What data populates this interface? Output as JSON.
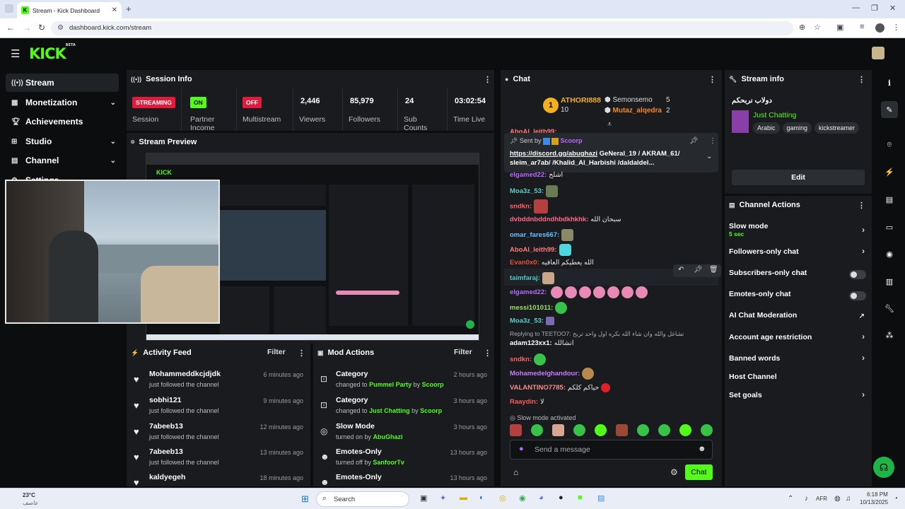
{
  "browser": {
    "tab_title": "Stream - Kick Dashboard",
    "url": "dashboard.kick.com/stream"
  },
  "header": {
    "logo": "KICK",
    "logo_badge": "BETA"
  },
  "sidebar": {
    "items": [
      {
        "label": "Stream",
        "icon": "broadcast-icon"
      },
      {
        "label": "Monetization",
        "icon": "dollar-icon"
      },
      {
        "label": "Achievements",
        "icon": "trophy-icon"
      },
      {
        "label": "Studio",
        "icon": "studio-icon"
      },
      {
        "label": "Channel",
        "icon": "channel-icon"
      },
      {
        "label": "Settings",
        "icon": "gear-icon"
      }
    ]
  },
  "session": {
    "title": "Session Info",
    "stats": [
      {
        "value": "STREAMING",
        "label": "Session",
        "badge_color": "#e21b3c"
      },
      {
        "value": "ON",
        "label": "Partner Income",
        "badge_color": "#53fc18"
      },
      {
        "value": "OFF",
        "label": "Multistream",
        "badge_color": "#e21b3c"
      },
      {
        "value": "2,446",
        "label": "Viewers"
      },
      {
        "value": "85,979",
        "label": "Followers"
      },
      {
        "value": "24",
        "label": "Sub Counts"
      },
      {
        "value": "03:02:54",
        "label": "Time Live"
      }
    ]
  },
  "preview": {
    "title": "Stream Preview"
  },
  "activity": {
    "title": "Activity Feed",
    "filter": "Filter",
    "rows": [
      {
        "name": "Mohammeddkcjdjdk",
        "sub": "just followed the channel",
        "time": "6 minutes ago"
      },
      {
        "name": "sobhi121",
        "sub": "just followed the channel",
        "time": "9 minutes ago"
      },
      {
        "name": "7abeeb13",
        "sub": "just followed the channel",
        "time": "12 minutes ago"
      },
      {
        "name": "7abeeb13",
        "sub": "just followed the channel",
        "time": "13 minutes ago"
      },
      {
        "name": "kaldyegeh",
        "sub": "",
        "time": "18 minutes ago"
      }
    ]
  },
  "mod": {
    "title": "Mod Actions",
    "filter": "Filter",
    "rows": [
      {
        "name": "Category",
        "prefix": "changed to",
        "value": "Pummel Party",
        "by": "by",
        "user": "Scoorp",
        "time": "2 hours ago"
      },
      {
        "name": "Category",
        "prefix": "changed to",
        "value": "Just Chatting",
        "by": "by",
        "user": "Scoorp",
        "time": "3 hours ago"
      },
      {
        "name": "Slow Mode",
        "prefix": "turned on by",
        "value": "AbuGhazi",
        "by": "",
        "user": "",
        "time": "3 hours ago"
      },
      {
        "name": "Emotes-Only",
        "prefix": "turned off by",
        "value": "SanfoorTv",
        "by": "",
        "user": "",
        "time": "13 hours ago"
      },
      {
        "name": "Emotes-Only",
        "prefix": "",
        "value": "",
        "by": "",
        "user": "",
        "time": "13 hours ago"
      }
    ]
  },
  "chat": {
    "title": "Chat",
    "leaders": [
      {
        "rank": "1",
        "name": "ATHORI888",
        "count": "10"
      },
      {
        "rank": "",
        "name": "Semonsemo",
        "count": "5"
      },
      {
        "rank": "",
        "name": "Mutaz_alqedra",
        "count": "2"
      }
    ],
    "pinned": {
      "sent_by": "Sent by",
      "sender": "Scoorp",
      "link": "https://discord.gg/abughazi",
      "text": "GeNeral_19 / AKRAM_61/ sleim_ar7ab/ /Khalid_Al_Harbishi /daldaldel..."
    },
    "partial_top": "AboAl_leith99:",
    "messages": [
      {
        "user": "elgamed22",
        "color": "#b968ff",
        "text": "اشلح"
      },
      {
        "user": "Moa3z_53",
        "color": "#5ad1c4",
        "text": ""
      },
      {
        "user": "sndkn",
        "color": "#ff6262",
        "text": ""
      },
      {
        "user": "dvbddnbddndhbdkhkhk",
        "color": "#ff6a8a",
        "text": "سبحان الله"
      },
      {
        "user": "omar_fares667",
        "color": "#6ac0ff",
        "text": ""
      },
      {
        "user": "AboAl_leith99",
        "color": "#ff7a7a",
        "text": ""
      },
      {
        "user": "Evan0x0",
        "color": "#e0533a",
        "text": "الله يعطيكم العافيه"
      },
      {
        "user": "taimfaraj",
        "color": "#53c8c8",
        "text": ""
      },
      {
        "user": "elgamed22",
        "color": "#b968ff",
        "text": ""
      },
      {
        "user": "messi101011",
        "color": "#9de06a",
        "text": ""
      },
      {
        "user": "Moa3z_53",
        "color": "#5ad1c4",
        "text": ""
      },
      {
        "user": "adam123xx1",
        "color": "#ffffff",
        "text": "انشالله"
      },
      {
        "user": "sndkn",
        "color": "#ff6262",
        "text": ""
      },
      {
        "user": "Mohamedelghandour",
        "color": "#c97bff",
        "text": ""
      },
      {
        "user": "VALANTINO7785",
        "color": "#ff8a8a",
        "text": "حياكم كلكم"
      },
      {
        "user": "Raaydin",
        "color": "#ff5b5b",
        "text": "لا"
      }
    ],
    "reply_label": "Replying to TEETOO7:",
    "reply_text": "تشاغل والله وان شاء الله بكره اول واحد تربح",
    "slow_mode": "Slow mode activated",
    "input_placeholder": "Send a message",
    "send": "Chat"
  },
  "stream_info": {
    "title": "Stream info",
    "stream_title": "دولاب نربحكم",
    "category": "Just Chatting",
    "tags": [
      "Arabic",
      "gaming",
      "kickstreamer"
    ],
    "edit": "Edit"
  },
  "channel_actions": {
    "title": "Channel Actions",
    "items": [
      {
        "label": "Slow mode",
        "sub": "5 sec",
        "control": "chevron"
      },
      {
        "label": "Followers-only chat",
        "sub": "",
        "control": "chevron"
      },
      {
        "label": "Subscribers-only chat",
        "sub": "",
        "control": "toggle"
      },
      {
        "label": "Emotes-only chat",
        "sub": "",
        "control": "toggle"
      },
      {
        "label": "AI Chat Moderation",
        "sub": "",
        "control": "external"
      },
      {
        "label": "Account age restriction",
        "sub": "",
        "control": "chevron"
      },
      {
        "label": "Banned words",
        "sub": "",
        "control": "chevron"
      },
      {
        "label": "Host Channel",
        "sub": "",
        "control": "none"
      },
      {
        "label": "Set goals",
        "sub": "",
        "control": "chevron"
      }
    ]
  },
  "taskbar": {
    "weather": "23°C",
    "weather_sub": "عاصف",
    "search": "Search",
    "lang": "AFR",
    "time": "6:18 PM",
    "date": "10/13/2025"
  },
  "colors": {
    "accent": "#53fc18",
    "panel": "#191b1f",
    "bg": "#0b0d0e",
    "live_red": "#e21b3c"
  }
}
